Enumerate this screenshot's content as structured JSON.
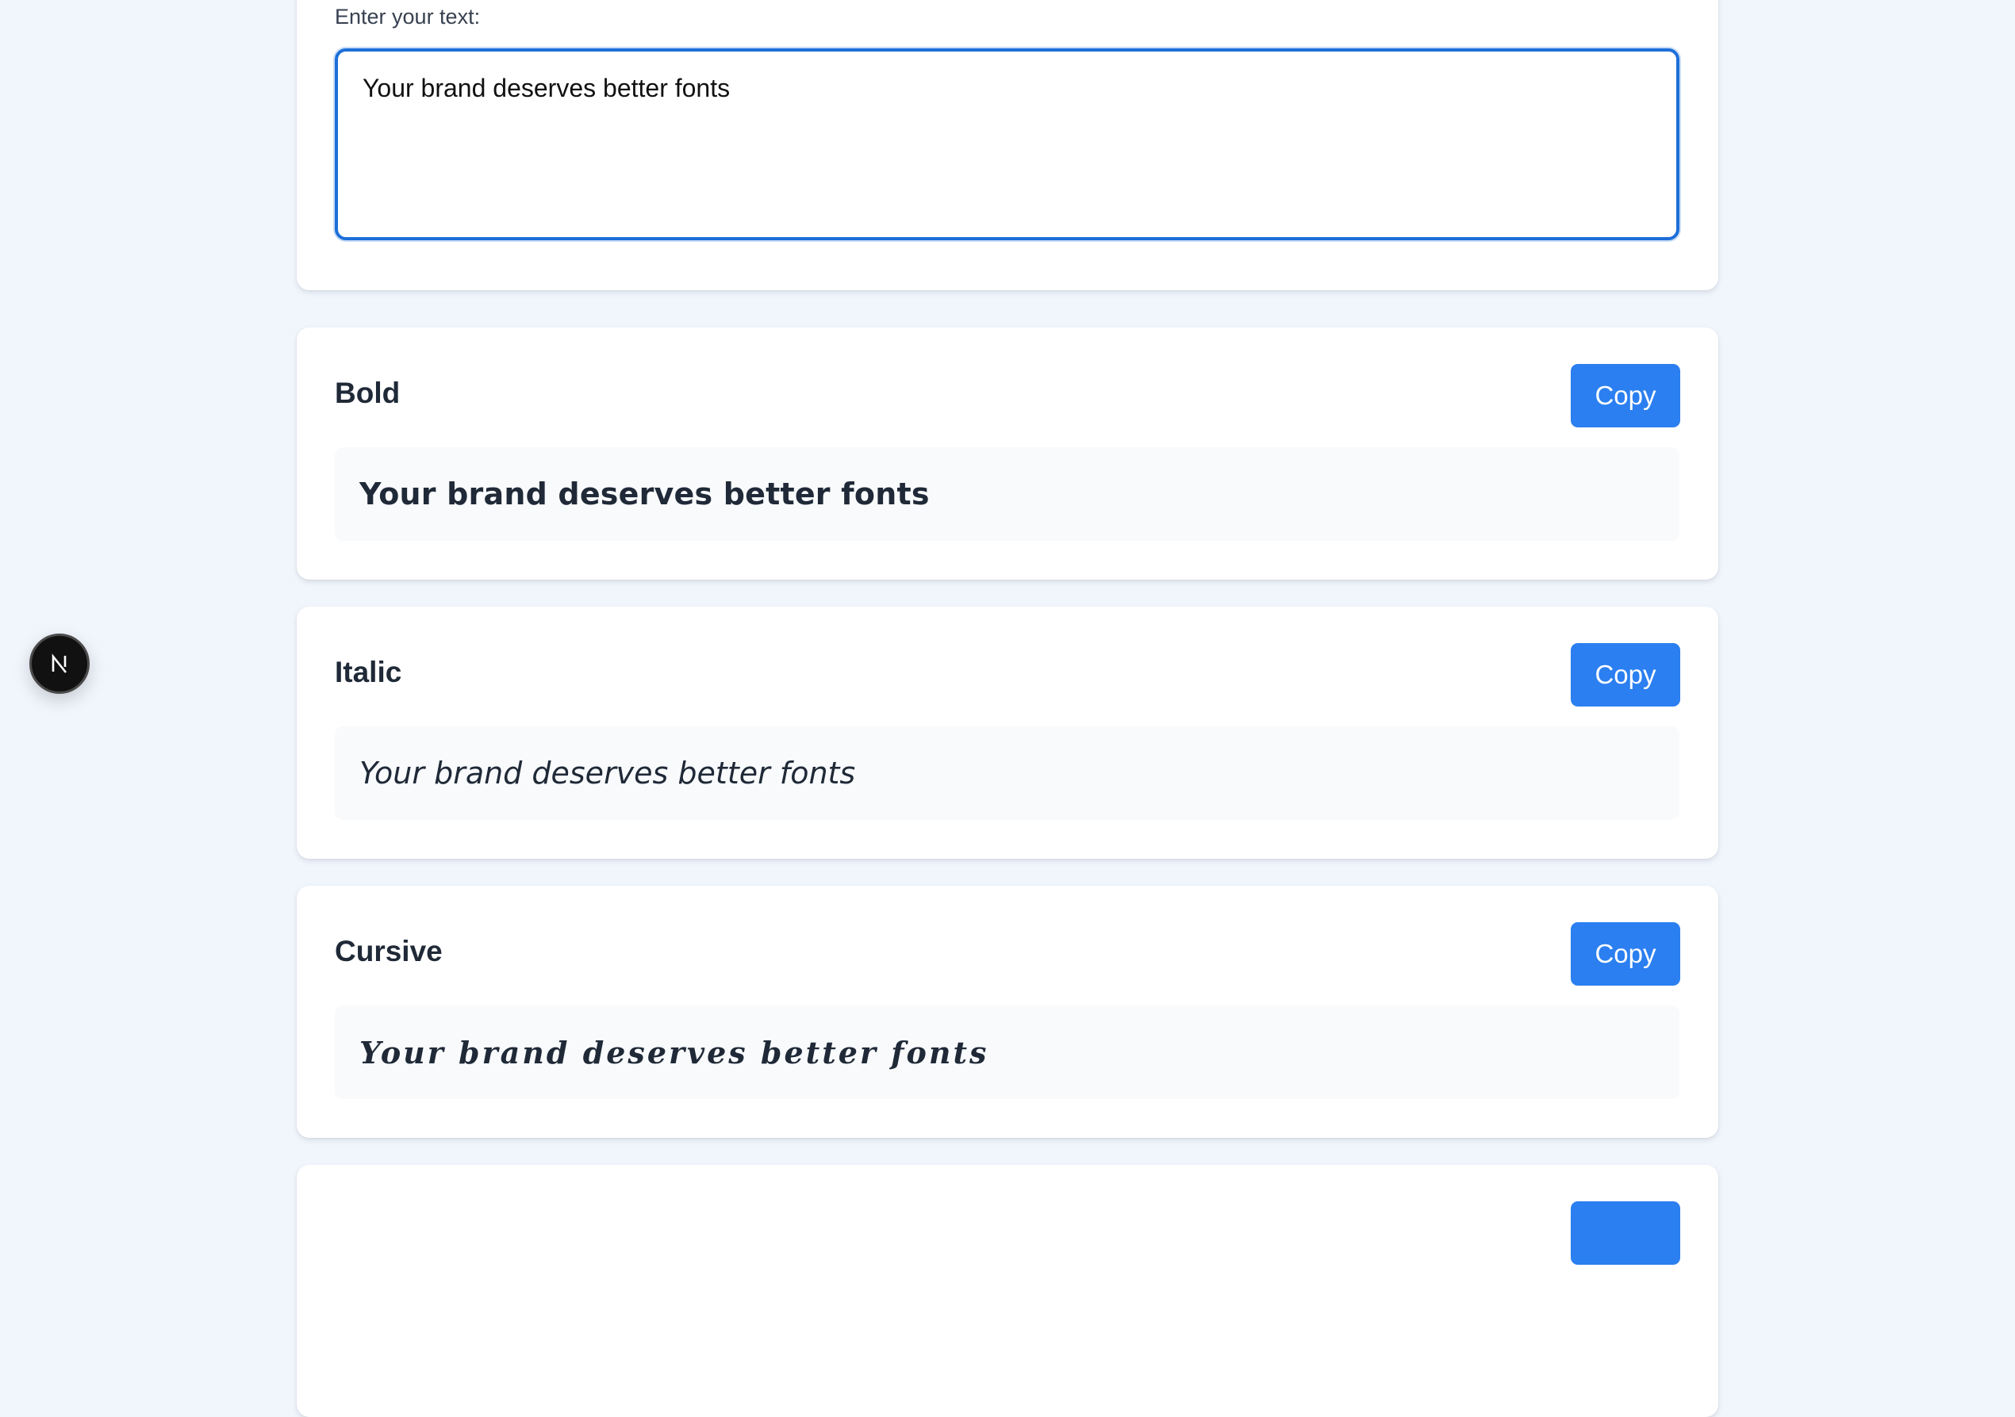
{
  "input": {
    "label": "Enter your text:",
    "value": "Your brand deserves better fonts"
  },
  "styles": [
    {
      "title": "Bold",
      "copy_label": "Copy",
      "preview": "Your brand deserves better fonts"
    },
    {
      "title": "Italic",
      "copy_label": "Copy",
      "preview": "Your brand deserves better fonts"
    },
    {
      "title": "Cursive",
      "copy_label": "Copy",
      "preview": "Your brand deserves better fonts"
    }
  ],
  "badge": {
    "icon": "nextjs-logo-icon"
  },
  "colors": {
    "accent": "#2b7ff0",
    "focus_border": "#1d6fd8",
    "background": "#f1f6fd",
    "card": "#ffffff",
    "preview_bg": "#f8fafc",
    "text": "#1f2937"
  }
}
